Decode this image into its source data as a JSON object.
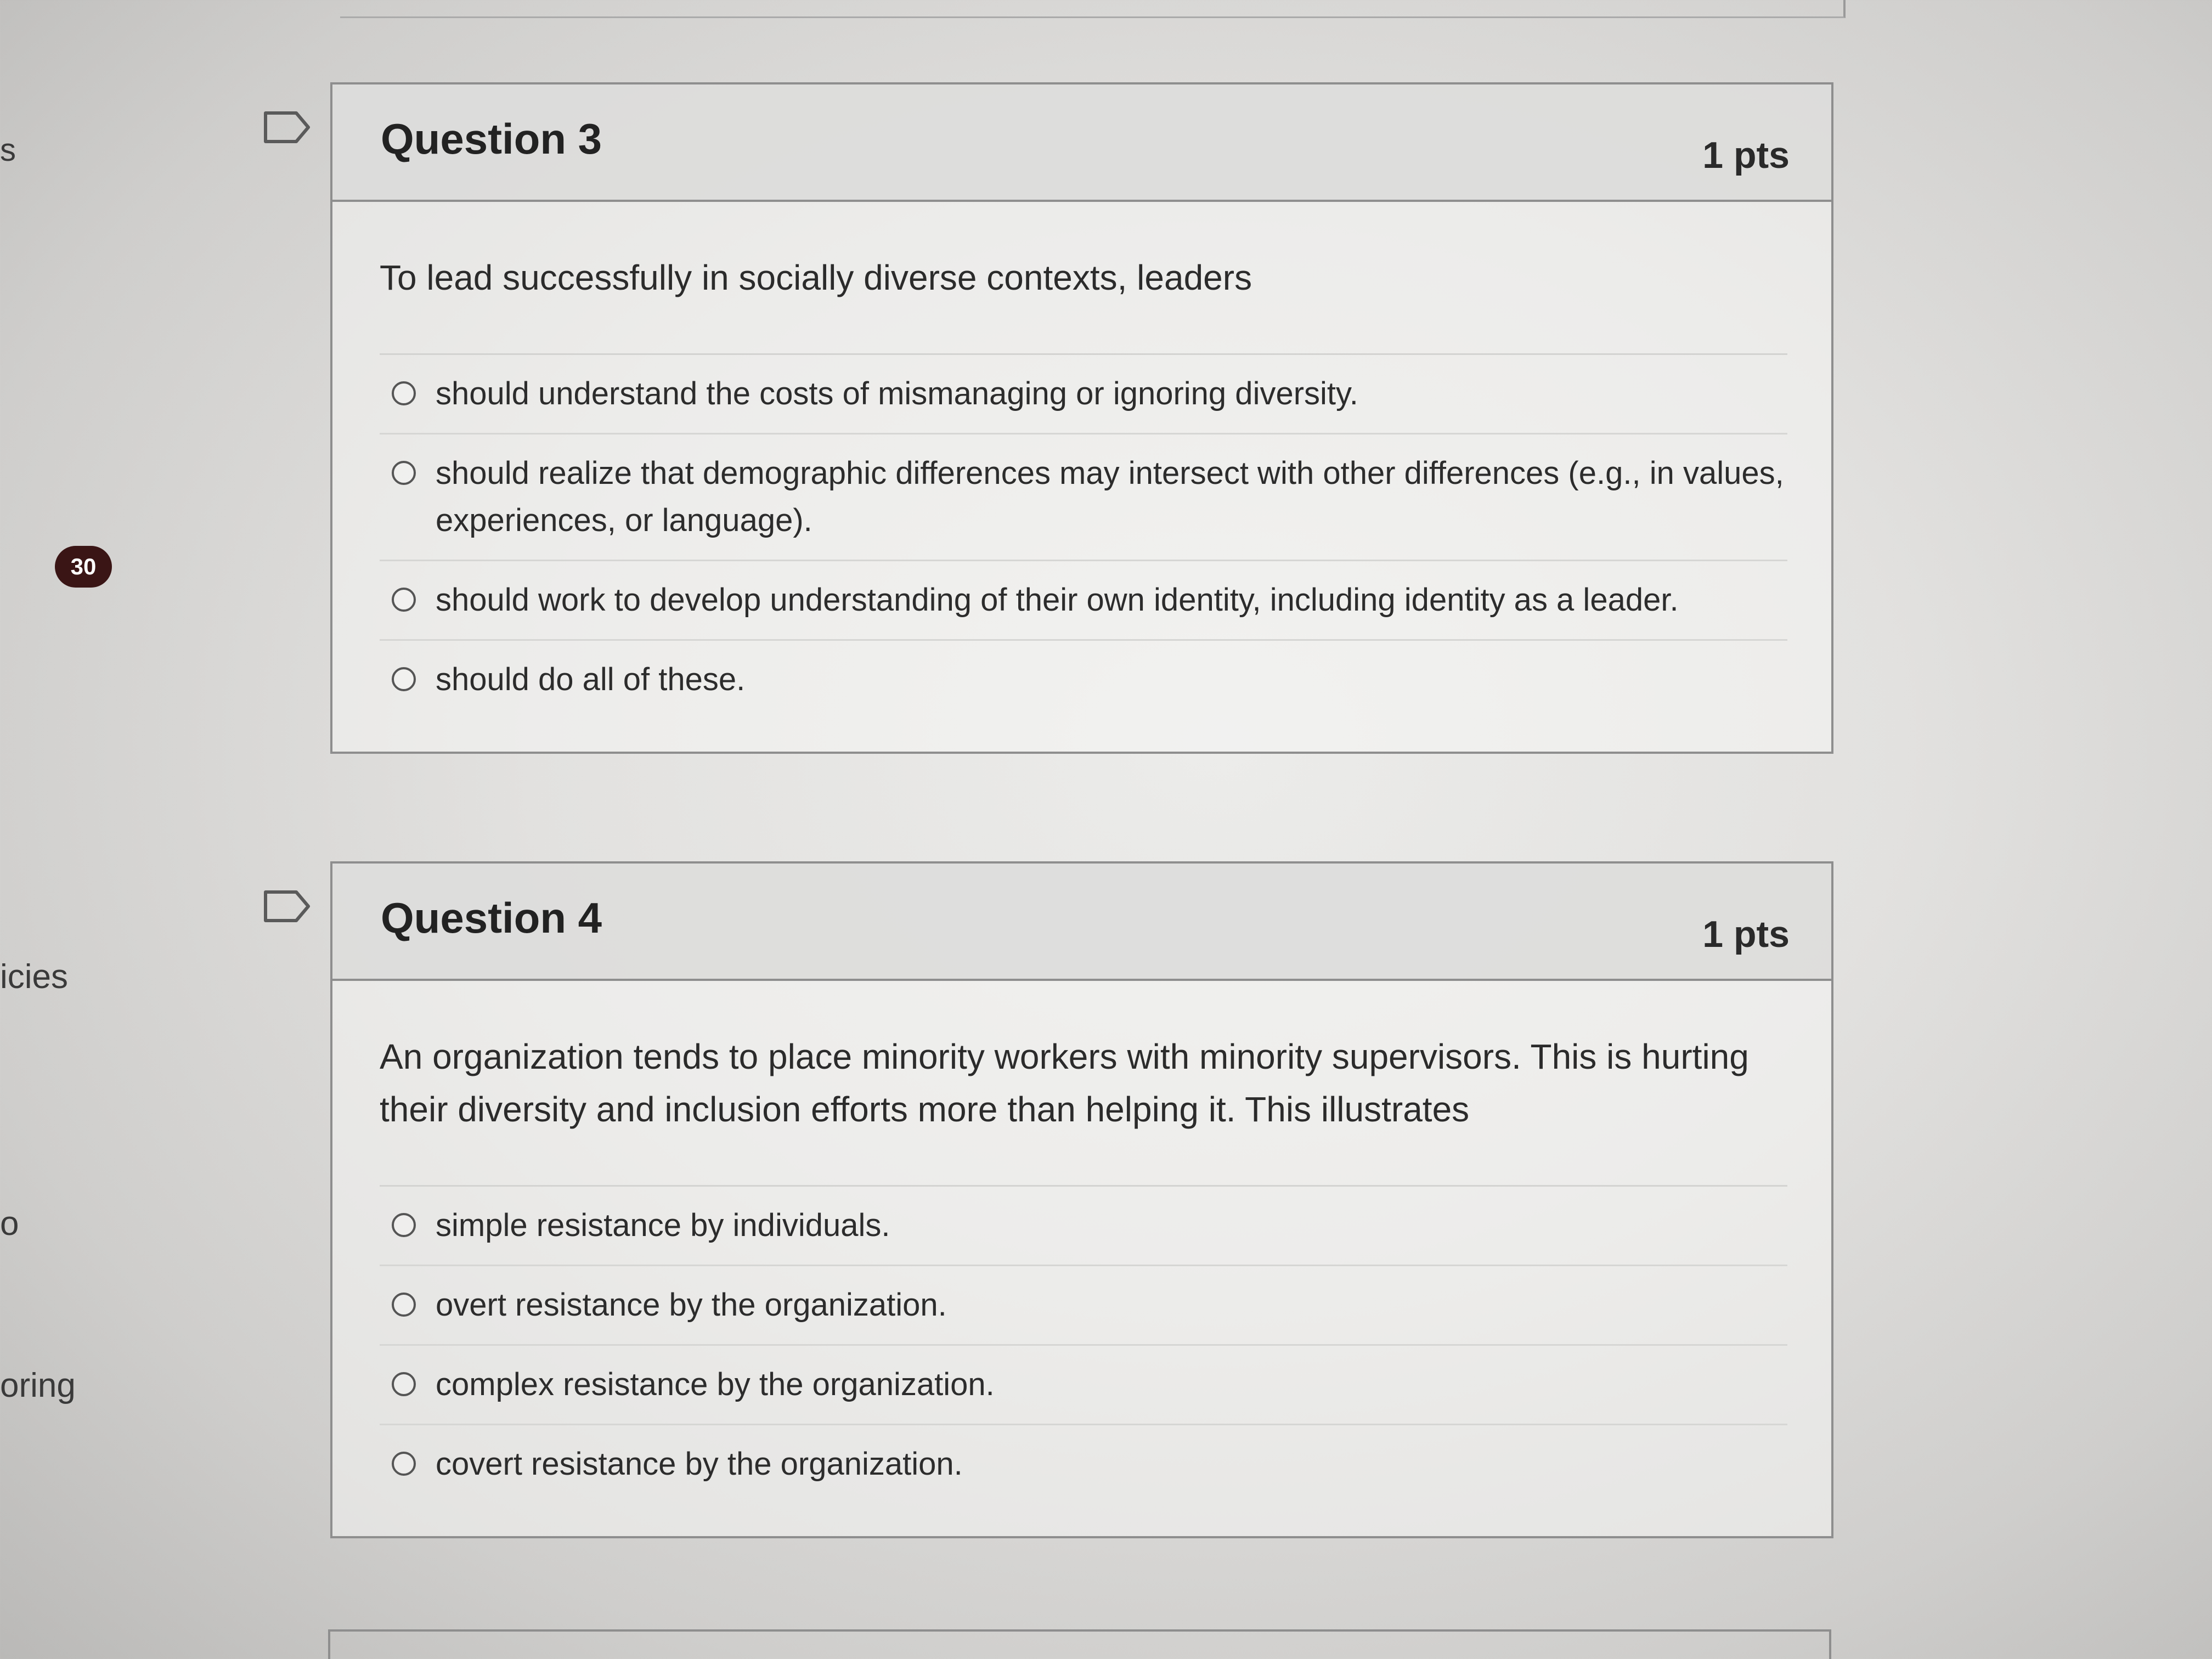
{
  "sidebar": {
    "fragments": {
      "s": "s",
      "icies": "icies",
      "o": "o",
      "oring": "oring"
    },
    "badge": "30"
  },
  "questions": [
    {
      "title": "Question 3",
      "points": "1 pts",
      "text": "To lead successfully in socially diverse contexts, leaders",
      "answers": [
        "should understand the costs of mismanaging or ignoring diversity.",
        "should realize that demographic differences may intersect with other differences (e.g., in values, experiences, or language).",
        "should work to develop understanding of their own identity, including identity as a leader.",
        "should do all of these."
      ]
    },
    {
      "title": "Question 4",
      "points": "1 pts",
      "text": "An organization tends to place minority workers with minority supervisors. This is hurting their diversity and inclusion efforts more than helping it. This illustrates",
      "answers": [
        "simple resistance by individuals.",
        "overt resistance by the organization.",
        "complex resistance by the organization.",
        "covert resistance by the organization."
      ]
    }
  ],
  "icons": {
    "flag": "flag-bookmark-icon",
    "radio": "radio-unselected-icon"
  },
  "colors": {
    "badge_bg": "#3a1515",
    "border": "#8e8e8e",
    "header_bg": "#dadad8"
  }
}
